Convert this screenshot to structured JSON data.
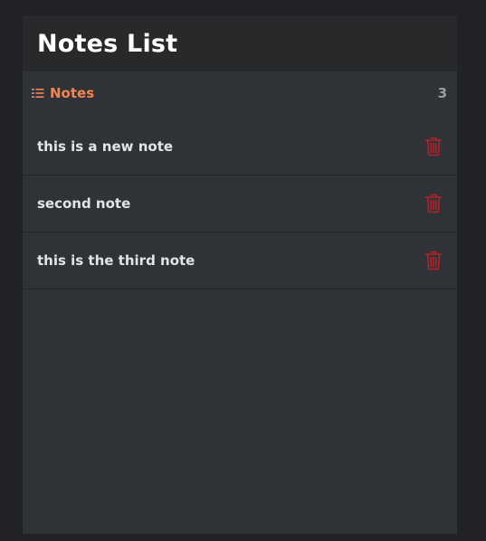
{
  "header": {
    "title": "Notes List"
  },
  "section": {
    "icon": "list-icon",
    "label": "Notes",
    "count": "3"
  },
  "notes": [
    {
      "text": "this is a new note",
      "delete_icon": "trash-icon"
    },
    {
      "text": "second note",
      "delete_icon": "trash-icon"
    },
    {
      "text": "this is the third note",
      "delete_icon": "trash-icon"
    }
  ],
  "colors": {
    "background": "#212225",
    "panel": "#2f3236",
    "title_bar": "#28292b",
    "accent": "#f08556",
    "delete": "#b3232b",
    "text": "#e3e4e6"
  }
}
